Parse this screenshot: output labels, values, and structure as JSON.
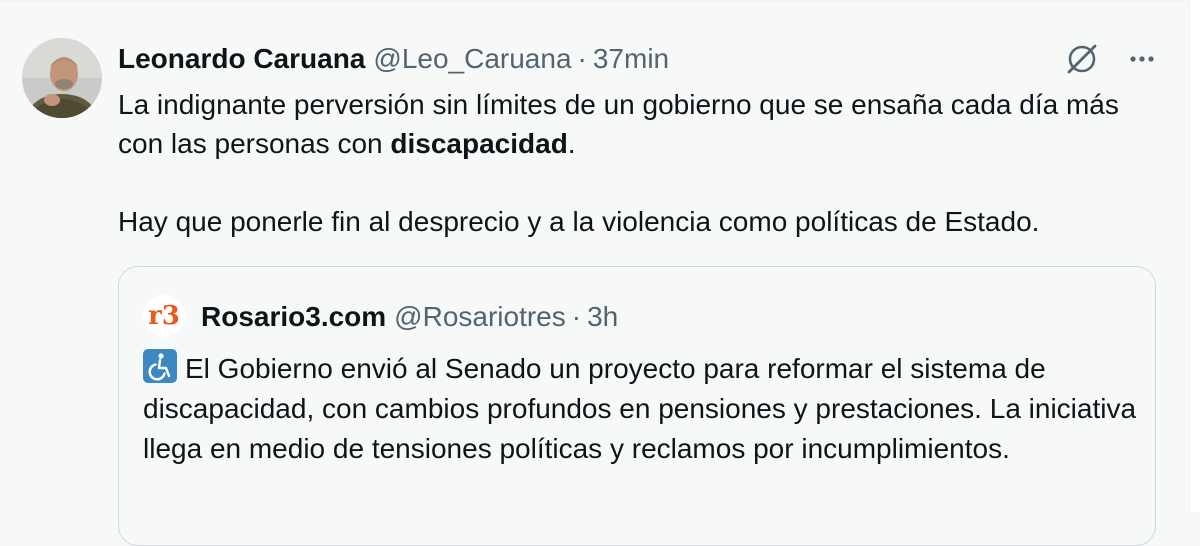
{
  "tweet": {
    "author_name": "Leonardo Caruana",
    "author_handle": "@Leo_Caruana",
    "separator": "·",
    "time": "37min",
    "text_line1_before": "La indignante perversión sin límites de un gobierno que se ensaña cada día más con las personas con ",
    "text_line1_bold": "discapacidad",
    "text_line1_after": ".",
    "text_paragraph2": "Hay que ponerle fin al desprecio y a la violencia como políticas de Estado."
  },
  "actions": {
    "grok_icon": "grok-slash-icon",
    "more_icon": "more-dots-icon"
  },
  "quote": {
    "logo_text_r": "r",
    "logo_text_3": "3",
    "author_name": "Rosario3.com",
    "author_handle": "@Rosariotres",
    "separator": "·",
    "time": "3h",
    "text": "El Gobierno envió al Senado un proyecto para reformar el sistema de discapacidad, con cambios profundos en pensiones y prestaciones. La iniciativa llega en medio de tensiones políticas y reclamos por incumplimientos.",
    "emoji_icon": "wheelchair-symbol-icon"
  },
  "colors": {
    "primary_text": "#0f1419",
    "secondary_text": "#536471",
    "border": "#cfd9de",
    "logo_accent": "#e85b1c",
    "emoji_blue": "#3b88c3"
  }
}
